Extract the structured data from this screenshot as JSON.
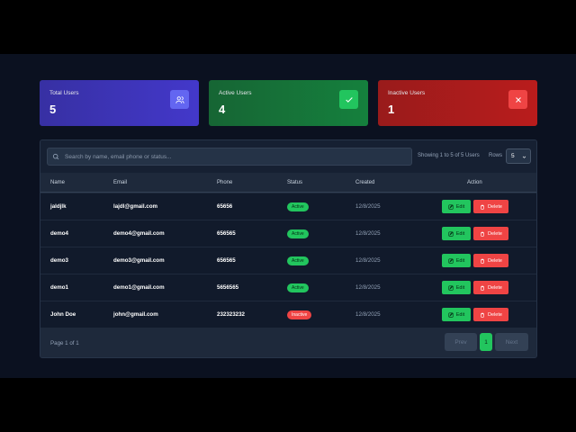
{
  "stats": [
    {
      "label": "Total Users",
      "value": "5",
      "icon": "users-icon"
    },
    {
      "label": "Active Users",
      "value": "4",
      "icon": "check-icon"
    },
    {
      "label": "Inactive Users",
      "value": "1",
      "icon": "x-icon"
    }
  ],
  "toolbar": {
    "search_placeholder": "Search by name, email phone or status...",
    "showing": "Showing 1 to 5 of 5 Users",
    "rows_label": "Rows",
    "rows_value": "5"
  },
  "table": {
    "headers": [
      "Name",
      "Email",
      "Phone",
      "Status",
      "Created",
      "Action"
    ],
    "rows": [
      {
        "name": "jaldjlk",
        "email": "lajdl@gmail.com",
        "phone": "65656",
        "status": "Active",
        "created": "12/8/2025"
      },
      {
        "name": "demo4",
        "email": "demo4@gmail.com",
        "phone": "656565",
        "status": "Active",
        "created": "12/8/2025"
      },
      {
        "name": "demo3",
        "email": "demo3@gmail.com",
        "phone": "656565",
        "status": "Active",
        "created": "12/8/2025"
      },
      {
        "name": "demo1",
        "email": "demo1@gmail.com",
        "phone": "5656565",
        "status": "Active",
        "created": "12/8/2025"
      },
      {
        "name": "John Doe",
        "email": "john@gmail.com",
        "phone": "232323232",
        "status": "Inactive",
        "created": "12/8/2025"
      }
    ],
    "edit_label": "Edit",
    "delete_label": "Delete"
  },
  "pagination": {
    "info": "Page 1 of 1",
    "prev_label": "Prev",
    "current": "1",
    "next_label": "Next"
  },
  "colors": {
    "background": "#0b1120",
    "panel": "#1e293b",
    "total_card": "#4338ca",
    "active_card": "#15803d",
    "inactive_card": "#b91c1c",
    "success": "#22c55e",
    "danger": "#ef4444"
  }
}
